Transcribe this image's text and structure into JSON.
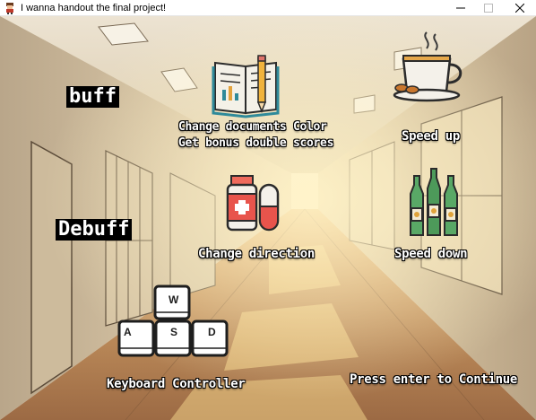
{
  "window": {
    "title": "I wanna handout the final project!",
    "controls": [
      "minimize-icon",
      "maximize-icon",
      "close-icon"
    ]
  },
  "sections": {
    "buff": "buff",
    "debuff": "Debuff"
  },
  "items": {
    "documents": {
      "icon": "book-pencil-icon",
      "line1": "Change documents Color",
      "line2": "Get bonus double scores"
    },
    "coffee": {
      "icon": "coffee-cup-icon",
      "label": "Speed up"
    },
    "pills": {
      "icon": "medicine-pills-icon",
      "label": "Change direction"
    },
    "bottles": {
      "icon": "beer-bottles-icon",
      "label": "Speed down"
    }
  },
  "controls_hint": {
    "keys": [
      "W",
      "A",
      "S",
      "D"
    ],
    "label": "Keyboard Controller"
  },
  "prompt": "Press enter to Continue",
  "colors": {
    "label_text": "#ffffff",
    "tag_background": "#000000",
    "floor": "#c08a55",
    "wall": "#e8d9bf",
    "sunlight": "#f7d98e"
  }
}
